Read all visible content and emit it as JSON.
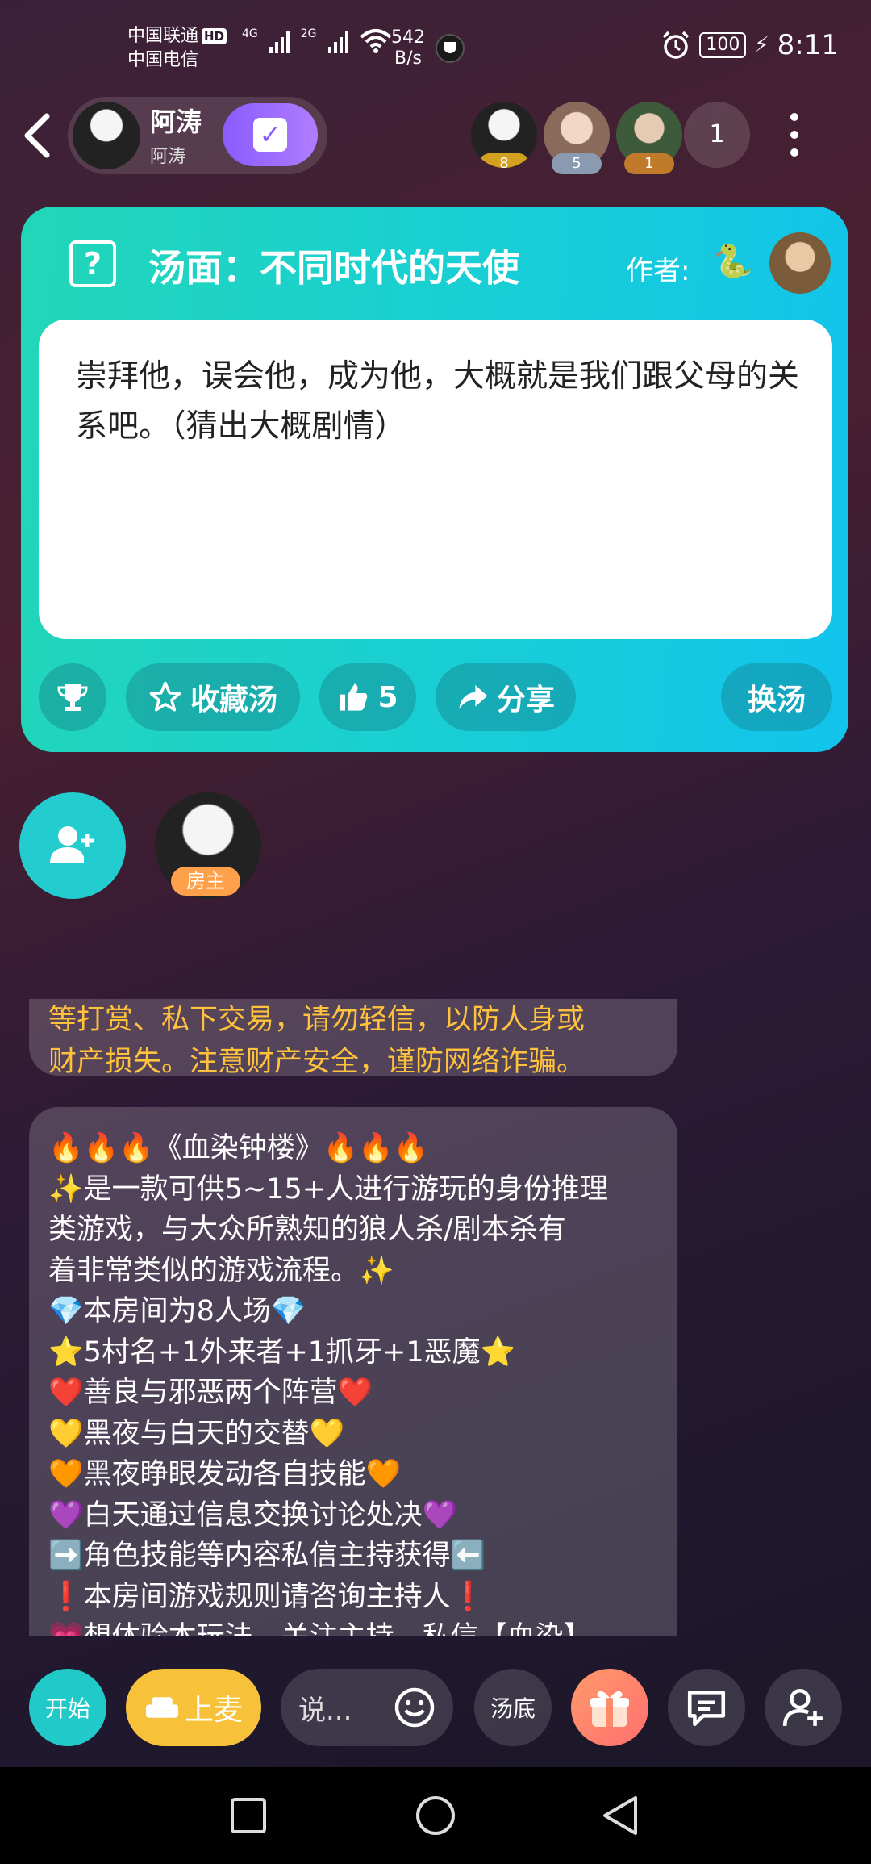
{
  "status_bar": {
    "carrier1": "中国联通",
    "hd": "HD",
    "carrier2": "中国电信",
    "net1": "4G",
    "net2": "2G",
    "speed_value": "542",
    "speed_unit": "B/s",
    "battery": "100",
    "time": "8:11"
  },
  "header": {
    "host_name": "阿涛",
    "host_sub": "阿涛",
    "viewers": [
      {
        "badge": "8",
        "color": "#d4a020"
      },
      {
        "badge": "5",
        "color": "#8a9ab0"
      },
      {
        "badge": "1",
        "color": "#c07a2a"
      }
    ],
    "viewer_count": "1"
  },
  "soup_card": {
    "title": "汤面：不同时代的天使",
    "author_label": "作者:",
    "author_emoji": "🐍",
    "text": "崇拜他，误会他，成为他，大概就是我们跟父母的关系吧。（猜出大概剧情）",
    "favorite_label": "收藏汤",
    "like_count": "5",
    "share_label": "分享",
    "change_label": "换汤"
  },
  "seats": {
    "host_tag": "房主"
  },
  "chat": {
    "warning_line1": "等打赏、私下交易，请勿轻信，以防人身或",
    "warning_line2": "财产损失。注意财产安全，谨防网络诈骗。",
    "intro_lines": [
      "🔥🔥🔥《血染钟楼》🔥🔥🔥",
      "✨是一款可供5~15+人进行游玩的身份推理",
      "类游戏，与大众所熟知的狼人杀/剧本杀有",
      "着非常类似的游戏流程。✨",
      "💎本房间为8人场💎",
      "⭐5村名+1外来者+1抓牙+1恶魔⭐",
      "❤️善良与邪恶两个阵营❤️",
      "💛黑夜与白天的交替💛",
      "🧡黑夜睁眼发动各自技能🧡",
      "💜白天通过信息交换讨论处决💜",
      "➡️角色技能等内容私信主持获得⬅️",
      "❗本房间游戏规则请咨询主持人❗",
      "💗想体验本玩法，关注主持，私信【血染】"
    ]
  },
  "bottom_bar": {
    "start_label": "开始",
    "mic_label": "上麦",
    "input_placeholder": "说...",
    "soup_bottom_label": "汤底"
  }
}
